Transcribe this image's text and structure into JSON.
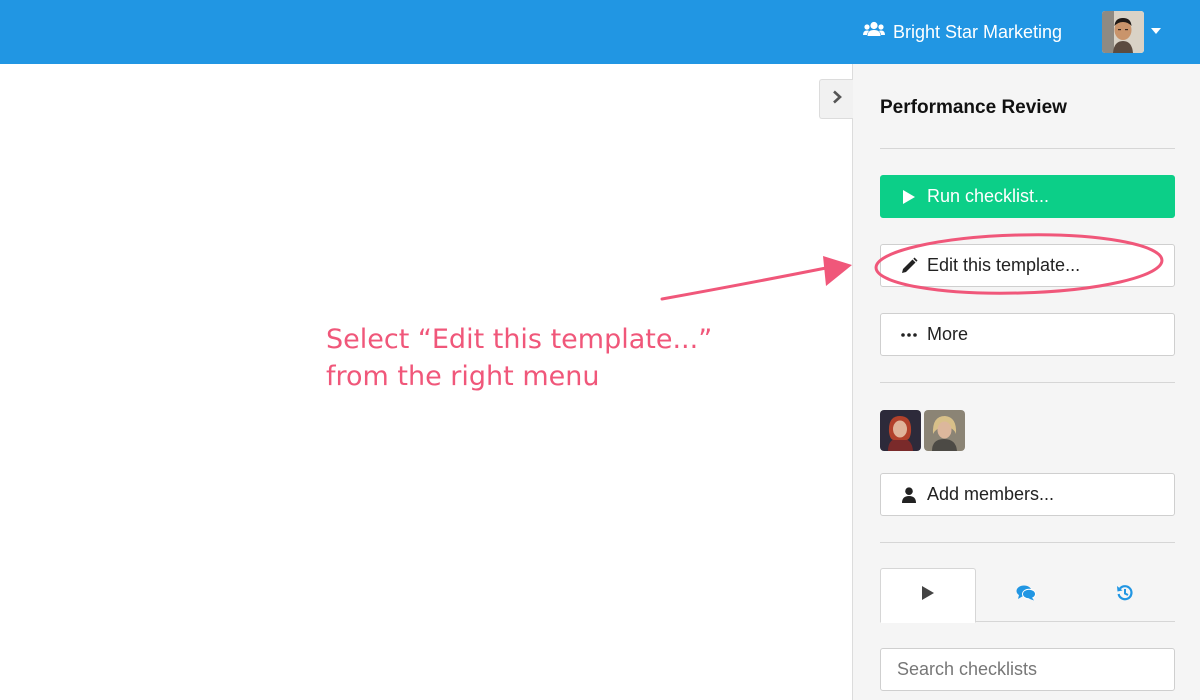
{
  "header": {
    "org_name": "Bright Star Marketing",
    "org_icon": "users-icon",
    "avatar": "user-avatar",
    "dropdown_icon": "caret-down-icon",
    "background_color": "#2196e3"
  },
  "sidebar": {
    "title": "Performance Review",
    "collapse_icon": "chevron-right-icon",
    "buttons": {
      "run": {
        "label": "Run checklist...",
        "icon": "play-icon",
        "color": "#0ccf88"
      },
      "edit": {
        "label": "Edit this template...",
        "icon": "pencil-icon"
      },
      "more": {
        "label": "More",
        "icon": "ellipsis-icon"
      },
      "add_members": {
        "label": "Add members...",
        "icon": "user-icon"
      }
    },
    "members": [
      "member-avatar-1",
      "member-avatar-2"
    ],
    "tabs": [
      {
        "icon": "play-icon",
        "active": true
      },
      {
        "icon": "comments-icon",
        "active": false
      },
      {
        "icon": "history-icon",
        "active": false
      }
    ],
    "search": {
      "placeholder": "Search checklists",
      "value": ""
    }
  },
  "annotation": {
    "line1": "Select “Edit this template...”",
    "line2": "from the right menu",
    "color": "#f0577a"
  }
}
